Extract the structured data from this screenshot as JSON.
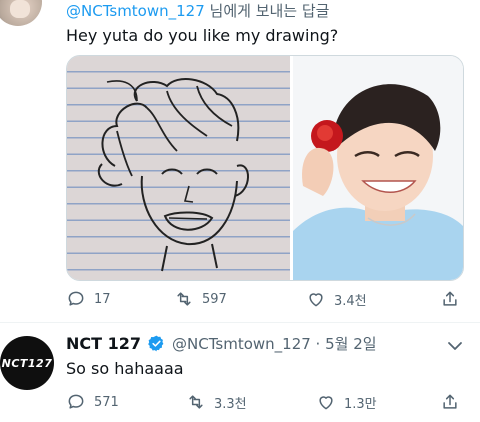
{
  "reply": {
    "handle": "@NCTsmtown_127",
    "suffix": " 님에게 보내는 답글"
  },
  "tweet1": {
    "text": "Hey yuta do you like my drawing?",
    "replies": "17",
    "retweets": "597",
    "likes": "3.4천"
  },
  "tweet2": {
    "name": "NCT 127",
    "avatar_text": "NCT127",
    "handle_date": "@NCTsmtown_127 · 5월 2일",
    "text": "So so hahaaaa",
    "replies": "571",
    "retweets": "3.3천",
    "likes": "1.3만"
  },
  "colors": {
    "accent": "#1d9bf0",
    "muted": "#536471"
  },
  "icons": [
    "reply-icon",
    "retweet-icon",
    "like-icon",
    "share-icon",
    "verified-icon",
    "more-icon"
  ]
}
